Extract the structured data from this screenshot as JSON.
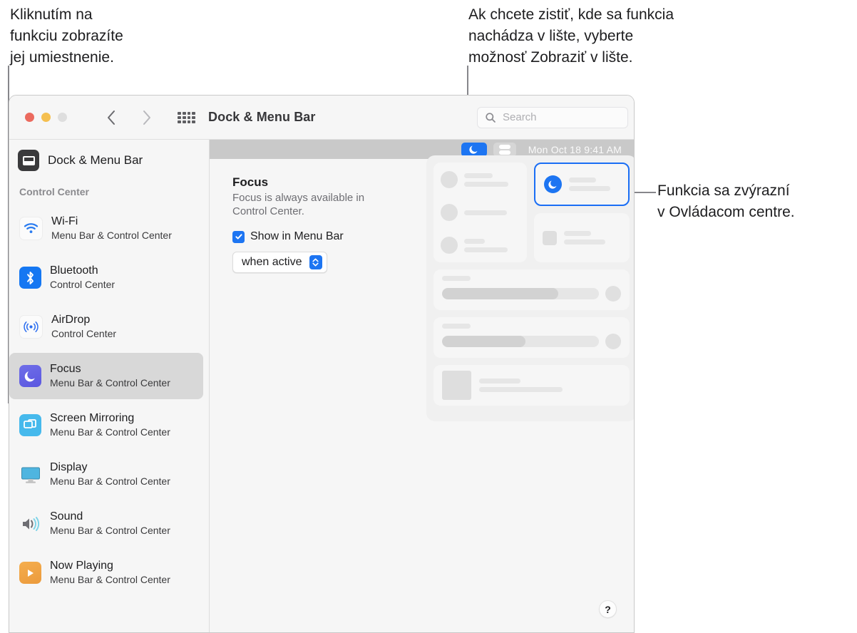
{
  "callouts": {
    "top_left": "Kliknutím na\nfunkciu zobrazíte\njej umiestnenie.",
    "top_right": "Ak chcete zistiť, kde sa funkcia\nnachádza v lište, vyberte\nmožnosť Zobraziť v lište.",
    "right": "Funkcia sa zvýrazní\nv Ovládacom centre."
  },
  "window": {
    "title": "Dock & Menu Bar",
    "traffic_lights": {
      "close": "close-button",
      "minimize": "minimize-button",
      "zoom": "zoom-button"
    },
    "nav": {
      "back": "back-chevron",
      "forward": "forward-chevron",
      "grid": "show-all-grid"
    },
    "search": {
      "placeholder": "Search",
      "value": ""
    }
  },
  "sidebar": {
    "header": {
      "label": "Dock & Menu Bar",
      "icon": "dock-menu-bar-icon"
    },
    "group_label": "Control Center",
    "items": [
      {
        "title": "Wi-Fi",
        "subtitle": "Menu Bar & Control Center",
        "icon": "wifi-icon",
        "selected": false
      },
      {
        "title": "Bluetooth",
        "subtitle": "Control Center",
        "icon": "bluetooth-icon",
        "selected": false
      },
      {
        "title": "AirDrop",
        "subtitle": "Control Center",
        "icon": "airdrop-icon",
        "selected": false
      },
      {
        "title": "Focus",
        "subtitle": "Menu Bar & Control Center",
        "icon": "focus-moon-icon",
        "selected": true
      },
      {
        "title": "Screen Mirroring",
        "subtitle": "Menu Bar & Control Center",
        "icon": "screen-mirroring-icon",
        "selected": false
      },
      {
        "title": "Display",
        "subtitle": "Menu Bar & Control Center",
        "icon": "display-icon",
        "selected": false
      },
      {
        "title": "Sound",
        "subtitle": "Menu Bar & Control Center",
        "icon": "sound-icon",
        "selected": false
      },
      {
        "title": "Now Playing",
        "subtitle": "Menu Bar & Control Center",
        "icon": "now-playing-icon",
        "selected": false
      }
    ]
  },
  "menu_bar_preview": {
    "focus_icon": "moon-icon",
    "control_center_icon": "control-center-icon",
    "clock": "Mon Oct 18  9:41 AM"
  },
  "detail": {
    "title": "Focus",
    "description": "Focus is always available in Control Center.",
    "checkbox": {
      "label": "Show in Menu Bar",
      "checked": true
    },
    "popup": {
      "value": "when active"
    }
  },
  "help": {
    "label": "?"
  },
  "colors": {
    "accent_blue": "#1d75f2",
    "highlight_border": "#1a6ef5",
    "focus_purple": "#5b57e0",
    "selected_row": "#d8d8d8",
    "menubar_gray": "#c9c9c9"
  }
}
